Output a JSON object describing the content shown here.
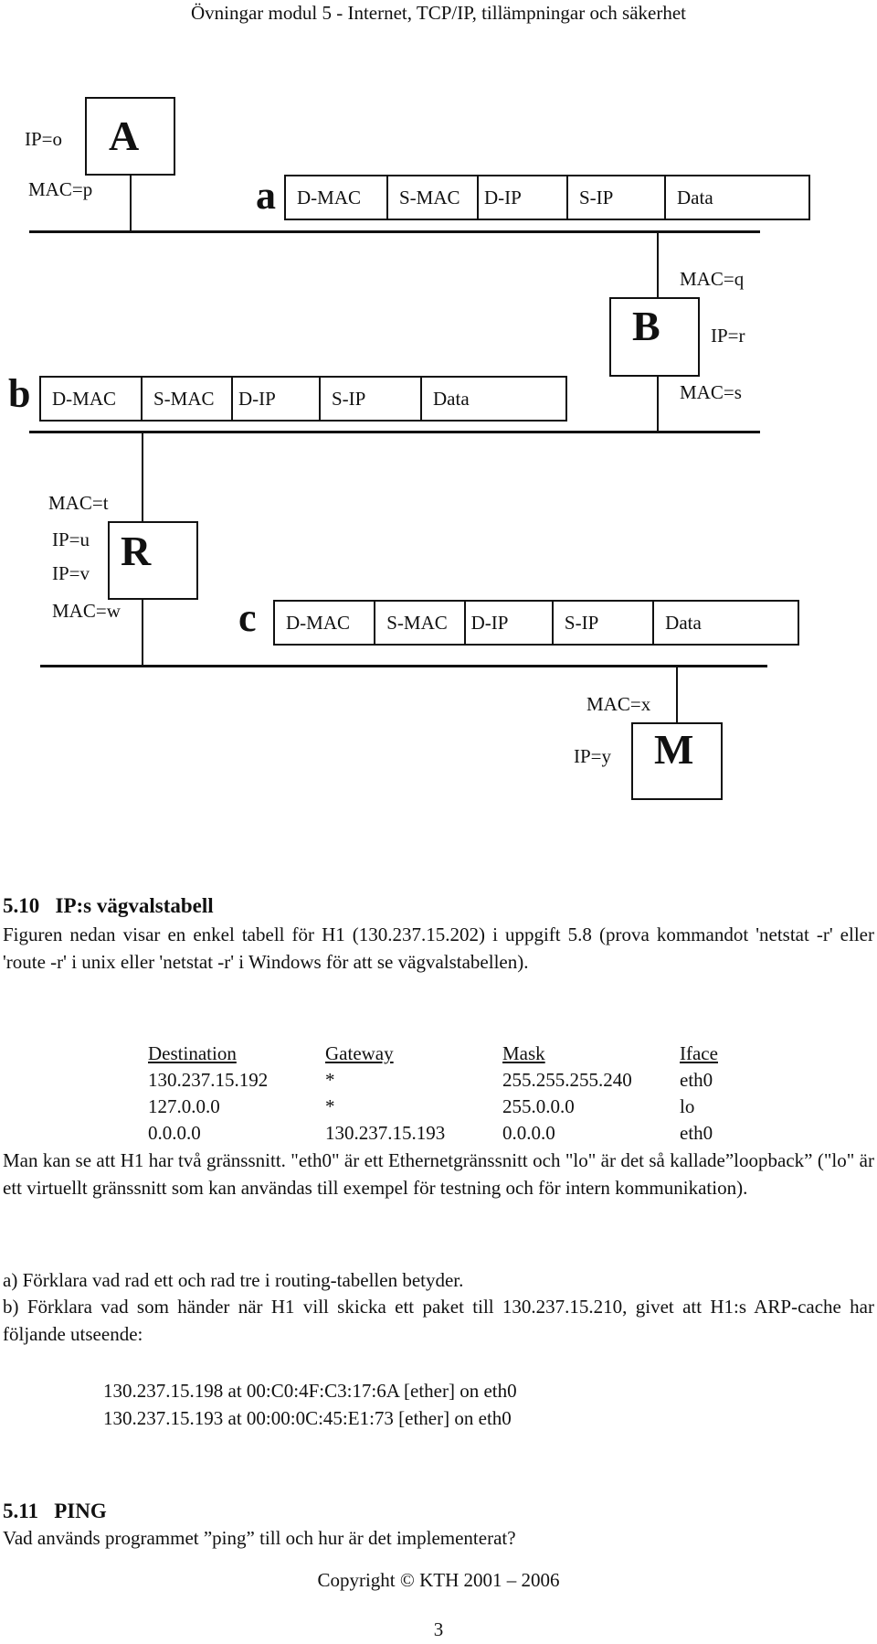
{
  "header": {
    "title": "Övningar modul 5 - Internet, TCP/IP, tillämpningar och säkerhet"
  },
  "diagram": {
    "nodes": {
      "A": {
        "letter": "A",
        "labels": [
          "IP=o",
          "MAC=p"
        ]
      },
      "B": {
        "letter": "B",
        "labels": [
          "MAC=q",
          "IP=r",
          "MAC=s"
        ]
      },
      "R": {
        "letter": "R",
        "labels": [
          "MAC=t",
          "IP=u",
          "IP=v",
          "MAC=w"
        ]
      },
      "M": {
        "letter": "M",
        "labels": [
          "MAC=x",
          "IP=y"
        ]
      }
    },
    "frames": [
      {
        "label": "a",
        "fields": [
          "D-MAC",
          "S-MAC",
          "D-IP",
          "S-IP",
          "Data"
        ]
      },
      {
        "label": "b",
        "fields": [
          "D-MAC",
          "S-MAC",
          "D-IP",
          "S-IP",
          "Data"
        ]
      },
      {
        "label": "c",
        "fields": [
          "D-MAC",
          "S-MAC",
          "D-IP",
          "S-IP",
          "Data"
        ]
      }
    ]
  },
  "section_510": {
    "number": "5.10",
    "title": "IP:s vägvalstabell",
    "intro": "Figuren nedan visar en enkel tabell för H1 (130.237.15.202) i uppgift 5.8 (prova kommandot 'netstat -r' eller 'route -r' i unix eller 'netstat -r' i Windows för att se vägvalstabellen).",
    "routing_table": {
      "headers": [
        "Destination",
        "Gateway",
        "Mask",
        "Iface"
      ],
      "rows": [
        [
          "130.237.15.192",
          "*",
          "255.255.255.240",
          "eth0"
        ],
        [
          "127.0.0.0",
          "*",
          "255.0.0.0",
          "lo"
        ],
        [
          "0.0.0.0",
          "130.237.15.193",
          "0.0.0.0",
          "eth0"
        ]
      ]
    },
    "explanation": "Man kan se att H1 har två gränssnitt. \"eth0\" är ett Ethernetgränssnitt och \"lo\" är det så kallade”loopback” (\"lo\" är ett virtuellt gränssnitt som kan användas till exempel för testning och för intern kommunikation).",
    "question_a": "a) Förklara vad rad ett och rad tre i routing-tabellen betyder.",
    "question_b": "b) Förklara vad som händer när H1 vill skicka ett paket till 130.237.15.210, givet att H1:s ARP-cache har följande utseende:",
    "arp_cache": [
      "130.237.15.198 at 00:C0:4F:C3:17:6A [ether] on eth0",
      "130.237.15.193 at 00:00:0C:45:E1:73 [ether] on eth0"
    ]
  },
  "section_511": {
    "number": "5.11",
    "title": "PING",
    "question": "Vad används programmet ”ping” till och hur är det implementerat?"
  },
  "footer": {
    "copyright": "Copyright © KTH 2001 – 2006",
    "page_number": "3"
  }
}
